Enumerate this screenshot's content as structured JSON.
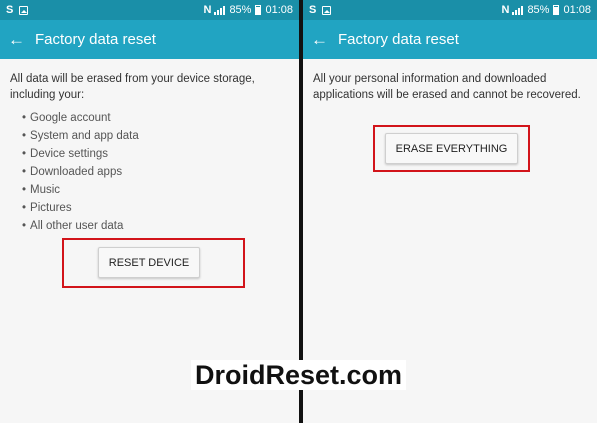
{
  "status_bar": {
    "time": "01:08",
    "battery": "85%",
    "carrier_glyph": "S"
  },
  "left_screen": {
    "title": "Factory data reset",
    "intro": "All data will be erased from your device storage, including your:",
    "items": [
      "Google account",
      "System and app data",
      "Device settings",
      "Downloaded apps",
      "Music",
      "Pictures",
      "All other user data"
    ],
    "button_label": "RESET DEVICE"
  },
  "right_screen": {
    "title": "Factory data reset",
    "message": "All your personal information and downloaded applications will be erased and cannot be recovered.",
    "button_label": "ERASE EVERYTHING"
  },
  "watermark": "DroidReset.com",
  "colors": {
    "status_bar": "#1a8fa8",
    "app_bar": "#21a4c2",
    "highlight": "#d2141a"
  }
}
